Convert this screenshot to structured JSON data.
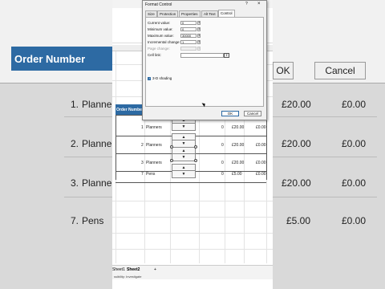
{
  "background": {
    "header_text": "Order Number",
    "ok_label": "OK",
    "cancel_label": "Cancel",
    "rows_left": [
      {
        "num": "1.",
        "product": "Planne"
      },
      {
        "num": "2.",
        "product": "Planne"
      },
      {
        "num": "3.",
        "product": "Planne"
      },
      {
        "num": "7.",
        "product": "Pens"
      }
    ],
    "rows_right": [
      {
        "price": "£20.00",
        "total": "£0.00"
      },
      {
        "price": "£20.00",
        "total": "£0.00"
      },
      {
        "price": "£20.00",
        "total": "£0.00"
      },
      {
        "price": "£5.00",
        "total": "£0.00"
      }
    ]
  },
  "excel": {
    "table_header": "Order Numbe",
    "rows": [
      {
        "num": "1",
        "product": "Planners",
        "qty": "0",
        "price": "£20.00",
        "total": "£0.00"
      },
      {
        "num": "2",
        "product": "Planners",
        "qty": "0",
        "price": "£20.00",
        "total": "£0.00"
      },
      {
        "num": "3",
        "product": "Planners",
        "qty": "0",
        "price": "£20.00",
        "total": "£0.00"
      },
      {
        "num": "7",
        "product": "Pens",
        "qty": "0",
        "price": "£5.00",
        "total": "£0.00"
      }
    ],
    "sheet_tabs": [
      "Sheet1",
      "Sheet2"
    ],
    "add_sheet": "+",
    "status": "ssibility: Investigate"
  },
  "dialog": {
    "title": "Format Control",
    "help": "?",
    "close": "×",
    "tabs": [
      "Size",
      "Protection",
      "Properties",
      "Alt Text",
      "Control"
    ],
    "active_tab": "Control",
    "fields": [
      {
        "label": "Current value:",
        "value": "0",
        "disabled": false
      },
      {
        "label": "Minimum value:",
        "value": "0",
        "disabled": false
      },
      {
        "label": "Maximum value:",
        "value": "30000",
        "disabled": false
      },
      {
        "label": "Incremental change:",
        "value": "1",
        "disabled": false
      },
      {
        "label": "Page change:",
        "value": "",
        "disabled": true
      }
    ],
    "cell_link_label": "Cell link:",
    "cell_link_value": "",
    "three_d_label": "3-D shading",
    "three_d_checked": true,
    "ok_label": "OK",
    "cancel_label": "Cancel"
  }
}
